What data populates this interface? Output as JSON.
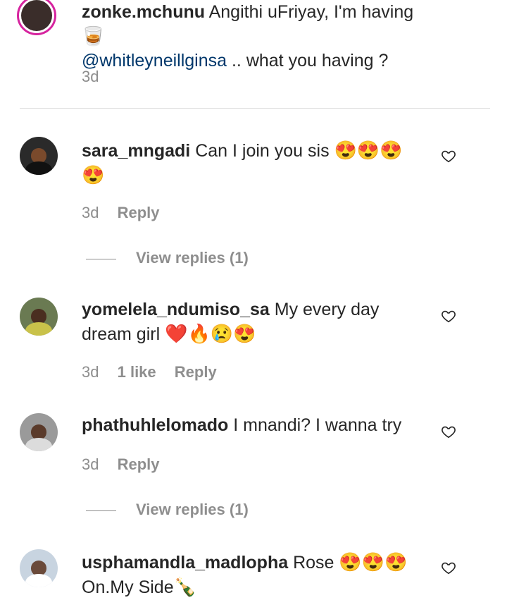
{
  "caption": {
    "username": "zonke.mchunu",
    "text_before": "Angithi uFriyay, I'm having",
    "drink_emoji": "🥃",
    "mention": "@whitleyneillginsa",
    "text_after": ".. what you having ?",
    "time": "3d"
  },
  "comments": [
    {
      "username": "sara_mngadi",
      "text": "Can I join you sis",
      "emojis": "😍😍😍",
      "emojis_line2": "😍",
      "time": "3d",
      "reply_label": "Reply",
      "view_replies": "View replies (1)"
    },
    {
      "username": "yomelela_ndumiso_sa",
      "text": "My every day",
      "text_line2": "dream girl",
      "emojis": "❤️🔥😢😍",
      "time": "3d",
      "likes": "1 like",
      "reply_label": "Reply"
    },
    {
      "username": "phathuhlelomado",
      "text": "I mnandi? I wanna try",
      "time": "3d",
      "reply_label": "Reply",
      "view_replies": "View replies (1)"
    },
    {
      "username": "usphamandla_madlopha",
      "text": "Rose",
      "emojis": "😍😍😍",
      "text_line2": "On.My Side",
      "emojis_line2": "🍾"
    }
  ],
  "icons": {
    "heart": "heart-outline-icon"
  },
  "colors": {
    "mention": "#00376b",
    "secondary_text": "#8e8e8e",
    "story_ring": "#d6249f"
  }
}
